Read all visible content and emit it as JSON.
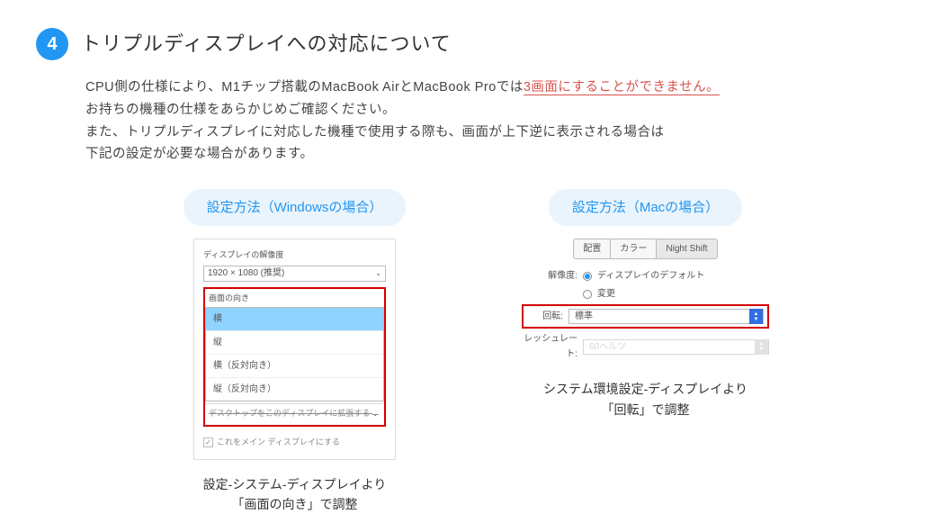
{
  "header": {
    "badge": "4",
    "title": "トリプルディスプレイへの対応について"
  },
  "body": {
    "line1_pre": "CPU側の仕様により、M1チップ搭載のMacBook AirとMacBook Proでは",
    "line1_warn": "3画面にすることができません。",
    "line2": "お持ちの機種の仕様をあらかじめご確認ください。",
    "line3": "また、トリプルディスプレイに対応した機種で使用する際も、画面が上下逆に表示される場合は",
    "line4": "下記の設定が必要な場合があります。"
  },
  "win": {
    "heading": "設定方法（Windowsの場合）",
    "res_label": "ディスプレイの解像度",
    "res_value": "1920 × 1080 (推奨)",
    "orient_label": "画面の向き",
    "options": [
      "横",
      "縦",
      "横（反対向き）",
      "縦（反対向き）"
    ],
    "footer_struck": "デスクトップをこのディスプレイに拡張する",
    "main_check": "これをメイン ディスプレイにする",
    "caption1": "設定-システム-ディスプレイより",
    "caption2": "「画面の向き」で調整"
  },
  "mac": {
    "heading": "設定方法（Macの場合）",
    "tabs": [
      "配置",
      "カラー",
      "Night Shift"
    ],
    "res_label": "解像度:",
    "res_default": "ディスプレイのデフォルト",
    "res_change": "変更",
    "rot_label": "回転:",
    "rot_value": "標準",
    "refresh_label": "レッシュレート:",
    "refresh_value": "60ヘルツ",
    "caption1": "システム環境設定-ディスプレイより",
    "caption2": "「回転」で調整"
  }
}
